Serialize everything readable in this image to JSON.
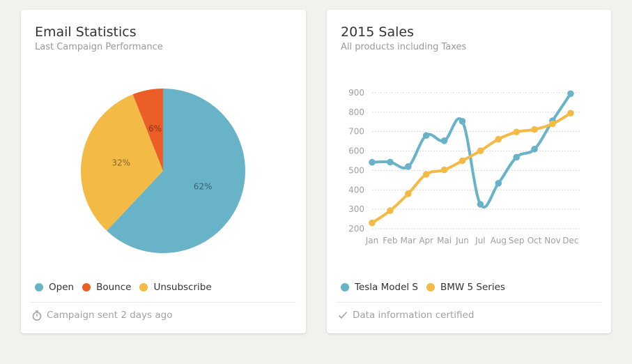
{
  "cards": {
    "email": {
      "title": "Email Statistics",
      "subtitle": "Last Campaign Performance",
      "legend": [
        {
          "label": "Open",
          "color": "#68b3c8"
        },
        {
          "label": "Bounce",
          "color": "#eb5e28"
        },
        {
          "label": "Unsubscribe",
          "color": "#f3bb45"
        }
      ],
      "footer": {
        "icon": "stopwatch-icon",
        "text": "Campaign sent 2 days ago"
      }
    },
    "sales": {
      "title": "2015 Sales",
      "subtitle": "All products including Taxes",
      "legend": [
        {
          "label": "Tesla Model S",
          "color": "#68b3c8"
        },
        {
          "label": "BMW 5 Series",
          "color": "#f3bb45"
        }
      ],
      "footer": {
        "icon": "check-icon",
        "text": "Data information certified"
      }
    }
  },
  "chart_data": [
    {
      "type": "pie",
      "labels": [
        "Open",
        "Bounce",
        "Unsubscribe"
      ],
      "values": [
        62,
        6,
        32
      ],
      "value_labels": [
        "62%",
        "6%",
        "32%"
      ],
      "colors": [
        "#68b3c8",
        "#eb5e28",
        "#f3bb45"
      ],
      "legend_position": "bottom-left"
    },
    {
      "type": "line",
      "categories": [
        "Jan",
        "Feb",
        "Mar",
        "Apr",
        "Mai",
        "Jun",
        "Jul",
        "Aug",
        "Sep",
        "Oct",
        "Nov",
        "Dec"
      ],
      "series": [
        {
          "name": "Tesla Model S",
          "color": "#68b3c8",
          "values": [
            542,
            543,
            520,
            680,
            653,
            753,
            326,
            434,
            568,
            610,
            756,
            895
          ]
        },
        {
          "name": "BMW 5 Series",
          "color": "#f3bb45",
          "values": [
            230,
            293,
            380,
            480,
            503,
            550,
            601,
            661,
            698,
            711,
            740,
            795
          ]
        }
      ],
      "ylim": [
        200,
        900
      ],
      "yticks": [
        200,
        300,
        400,
        500,
        600,
        700,
        800,
        900
      ],
      "grid": true,
      "legend_position": "bottom-left"
    }
  ]
}
